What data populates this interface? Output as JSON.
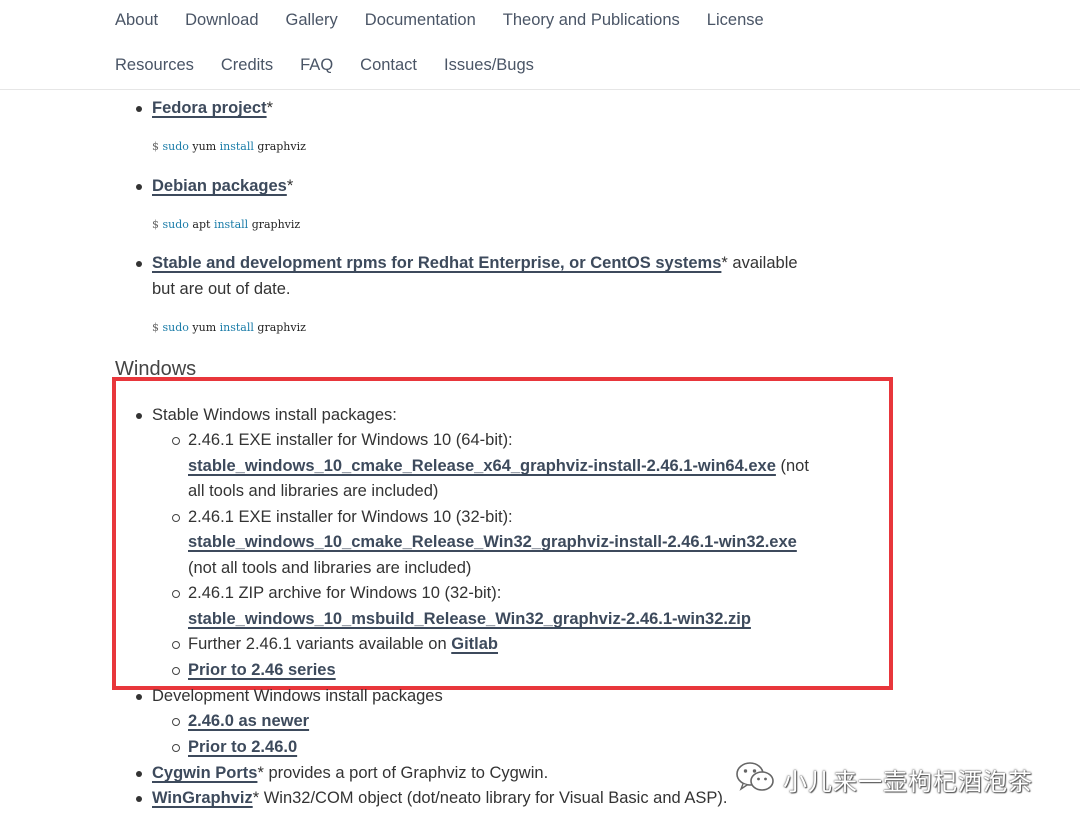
{
  "nav": {
    "row1": [
      "About",
      "Download",
      "Gallery",
      "Documentation",
      "Theory and Publications",
      "License"
    ],
    "row2": [
      "Resources",
      "Credits",
      "FAQ",
      "Contact",
      "Issues/Bugs"
    ]
  },
  "linux": {
    "fedora": {
      "link": "Fedora project",
      "suffix": "*",
      "cmd": {
        "prompt": "$",
        "sudo": "sudo",
        "mgr": "yum",
        "install": "install",
        "pkg": "graphviz"
      }
    },
    "debian": {
      "link": "Debian packages",
      "suffix": "*",
      "cmd": {
        "prompt": "$",
        "sudo": "sudo",
        "mgr": "apt",
        "install": "install",
        "pkg": "graphviz"
      }
    },
    "rpms": {
      "link": "Stable and development rpms for Redhat Enterprise, or CentOS systems",
      "suffix": "* available",
      "line2": "but are out of date.",
      "cmd": {
        "prompt": "$",
        "sudo": "sudo",
        "mgr": "yum",
        "install": "install",
        "pkg": "graphviz"
      }
    }
  },
  "windows": {
    "title": "Windows",
    "stable_label": "Stable Windows install packages:",
    "items": [
      {
        "text": "2.46.1 EXE installer for Windows 10 (64-bit):",
        "link": "stable_windows_10_cmake_Release_x64_graphviz-install-2.46.1-win64.exe",
        "after": " (not",
        "line3": "all tools and libraries are included)"
      },
      {
        "text": "2.46.1 EXE installer for Windows 10 (32-bit):",
        "link": "stable_windows_10_cmake_Release_Win32_graphviz-install-2.46.1-win32.exe",
        "line3": "(not all tools and libraries are included)"
      },
      {
        "text": "2.46.1 ZIP archive for Windows 10 (32-bit):",
        "link": "stable_windows_10_msbuild_Release_Win32_graphviz-2.46.1-win32.zip"
      }
    ],
    "further_text": "Further 2.46.1 variants available on ",
    "further_link": "Gitlab",
    "prior_link": "Prior to 2.46 series",
    "dev_label": "Development Windows install packages",
    "dev_items": [
      "2.46.0 as newer",
      "Prior to 2.46.0"
    ],
    "cygwin": {
      "link": "Cygwin Ports",
      "text": "* provides a port of Graphviz to Cygwin."
    },
    "wingraphviz": {
      "link": "WinGraphviz",
      "text": "* Win32/COM object (dot/neato library for Visual Basic and ASP)."
    }
  },
  "watermark": {
    "text": "小儿来一壶枸杞酒泡茶"
  }
}
